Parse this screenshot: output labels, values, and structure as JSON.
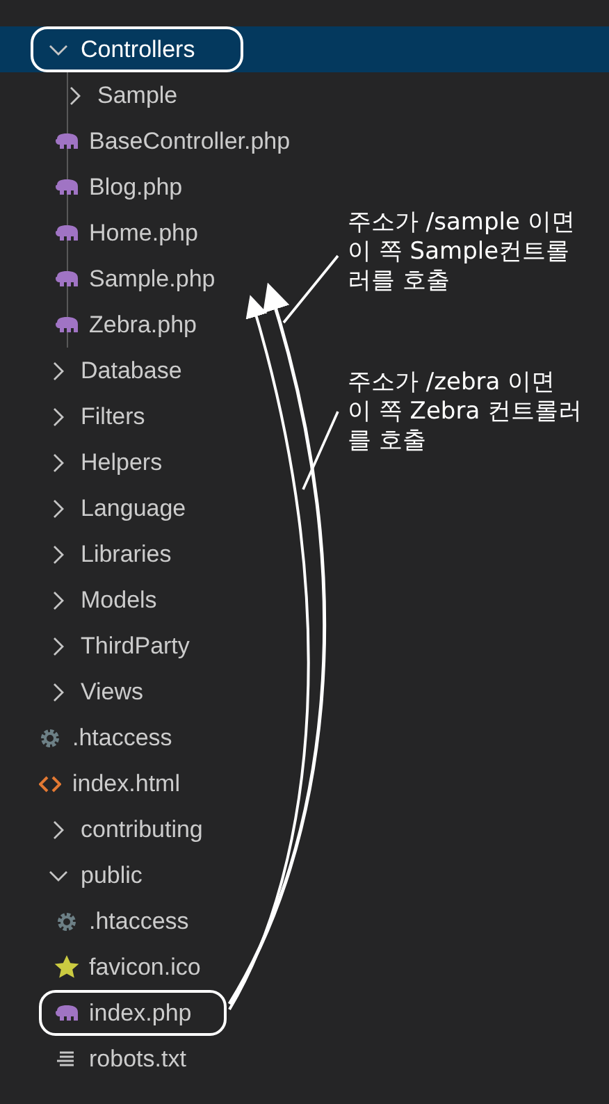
{
  "tree": [
    {
      "kind": "folder",
      "children": [
        {
          "kind": "folder",
          "label": "Controllers",
          "expanded": true,
          "selected": true,
          "circled": true,
          "children": [
            {
              "kind": "folder",
              "label": "Sample",
              "expanded": false,
              "selected": false,
              "circled": false
            },
            {
              "kind": "php",
              "label": "BaseController.php",
              "selected": false,
              "circled": false
            },
            {
              "kind": "php",
              "label": "Blog.php",
              "selected": false,
              "circled": false
            },
            {
              "kind": "php",
              "label": "Home.php",
              "selected": false,
              "circled": false
            },
            {
              "kind": "php",
              "label": "Sample.php",
              "selected": false,
              "circled": false
            },
            {
              "kind": "php",
              "label": "Zebra.php",
              "selected": false,
              "circled": false
            }
          ]
        },
        {
          "kind": "folder",
          "label": "Database",
          "expanded": false,
          "selected": false,
          "circled": false
        },
        {
          "kind": "folder",
          "label": "Filters",
          "expanded": false,
          "selected": false,
          "circled": false
        },
        {
          "kind": "folder",
          "label": "Helpers",
          "expanded": false,
          "selected": false,
          "circled": false
        },
        {
          "kind": "folder",
          "label": "Language",
          "expanded": false,
          "selected": false,
          "circled": false
        },
        {
          "kind": "folder",
          "label": "Libraries",
          "expanded": false,
          "selected": false,
          "circled": false
        },
        {
          "kind": "folder",
          "label": "Models",
          "expanded": false,
          "selected": false,
          "circled": false
        },
        {
          "kind": "folder",
          "label": "ThirdParty",
          "expanded": false,
          "selected": false,
          "circled": false
        },
        {
          "kind": "folder",
          "label": "Views",
          "expanded": false,
          "selected": false,
          "circled": false
        },
        {
          "kind": "config",
          "label": ".htaccess",
          "selected": false,
          "circled": false
        },
        {
          "kind": "html",
          "label": "index.html",
          "selected": false,
          "circled": false
        }
      ]
    },
    {
      "kind": "folder",
      "label": "contributing",
      "expanded": false,
      "selected": false,
      "circled": false
    },
    {
      "kind": "folder",
      "label": "public",
      "expanded": true,
      "selected": false,
      "circled": false,
      "children": [
        {
          "kind": "config",
          "label": ".htaccess",
          "selected": false,
          "circled": false
        },
        {
          "kind": "favicon",
          "label": "favicon.ico",
          "selected": false,
          "circled": false
        },
        {
          "kind": "php",
          "label": "index.php",
          "selected": false,
          "circled": true
        },
        {
          "kind": "text",
          "label": "robots.txt",
          "selected": false,
          "circled": false
        }
      ]
    }
  ],
  "notes": [
    {
      "text": "주소가 /sample 이면\n이 쪽  Sample컨트롤\n러를 호출"
    },
    {
      "text": "주소가 /zebra 이면\n이 쪽  Zebra 컨트롤러\n를 호출"
    }
  ]
}
